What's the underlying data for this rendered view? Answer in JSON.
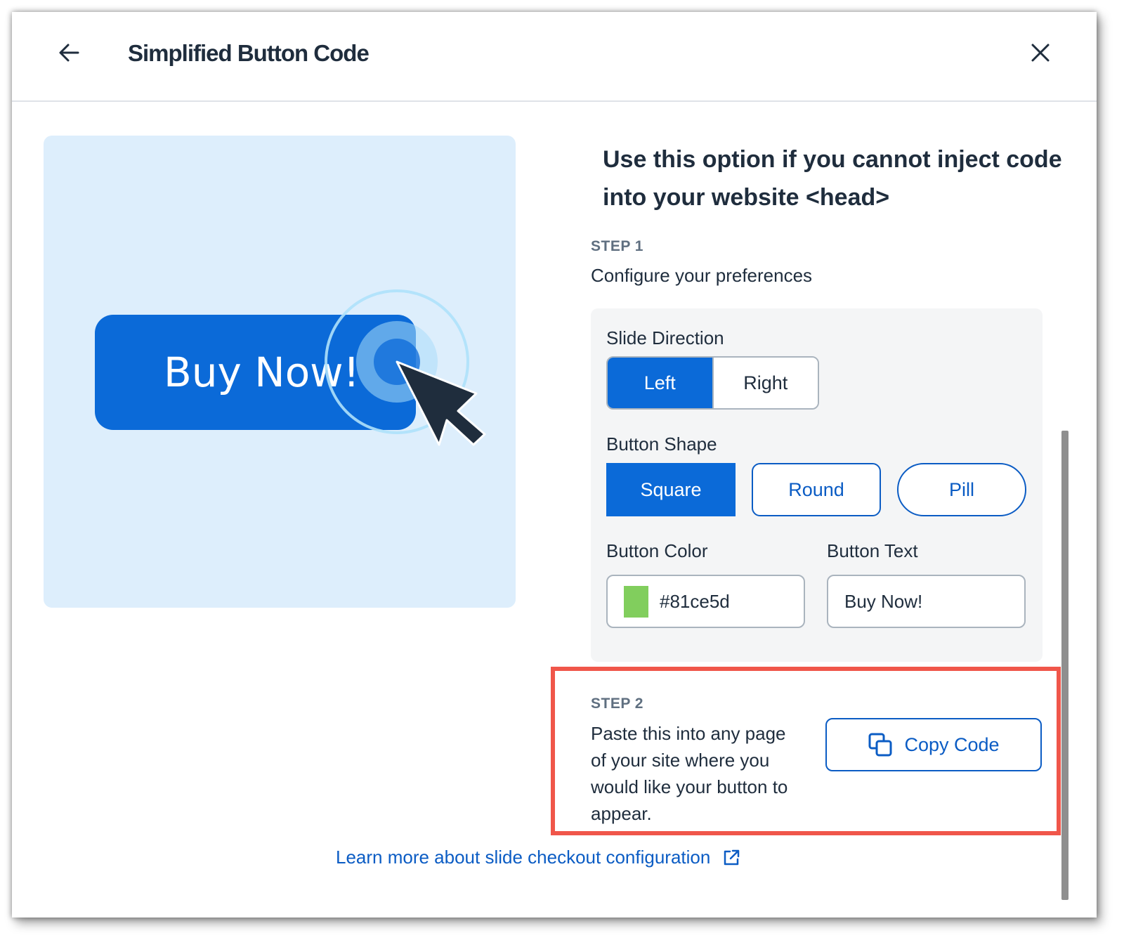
{
  "header": {
    "title": "Simplified Button Code",
    "back_icon": "arrow-left-icon",
    "close_icon": "close-icon"
  },
  "preview": {
    "button_text": "Buy Now!",
    "cursor_icon": "cursor-pointer-icon",
    "button_color": "#0b6ad8",
    "background_color": "#ddeefc"
  },
  "intro": {
    "heading": "Use this option if you cannot inject code into your website <head>"
  },
  "step1": {
    "label": "STEP 1",
    "description": "Configure your preferences",
    "slide_direction": {
      "label": "Slide Direction",
      "options": [
        "Left",
        "Right"
      ],
      "selected": "Left"
    },
    "button_shape": {
      "label": "Button Shape",
      "options": [
        "Square",
        "Round",
        "Pill"
      ],
      "selected": "Square"
    },
    "button_color": {
      "label": "Button Color",
      "value": "#81ce5d",
      "swatch": "#81ce5d"
    },
    "button_text": {
      "label": "Button Text",
      "value": "Buy Now!"
    }
  },
  "step2": {
    "label": "STEP 2",
    "description": "Paste this into any page of your site where you would like your button to appear.",
    "copy_button": "Copy Code",
    "copy_icon": "copy-icon"
  },
  "footer": {
    "learn_more": "Learn more about slide checkout configuration",
    "external_icon": "external-link-icon"
  },
  "colors": {
    "accent": "#0b6ad8",
    "link": "#0b5cc4",
    "highlight": "#f0564a"
  }
}
